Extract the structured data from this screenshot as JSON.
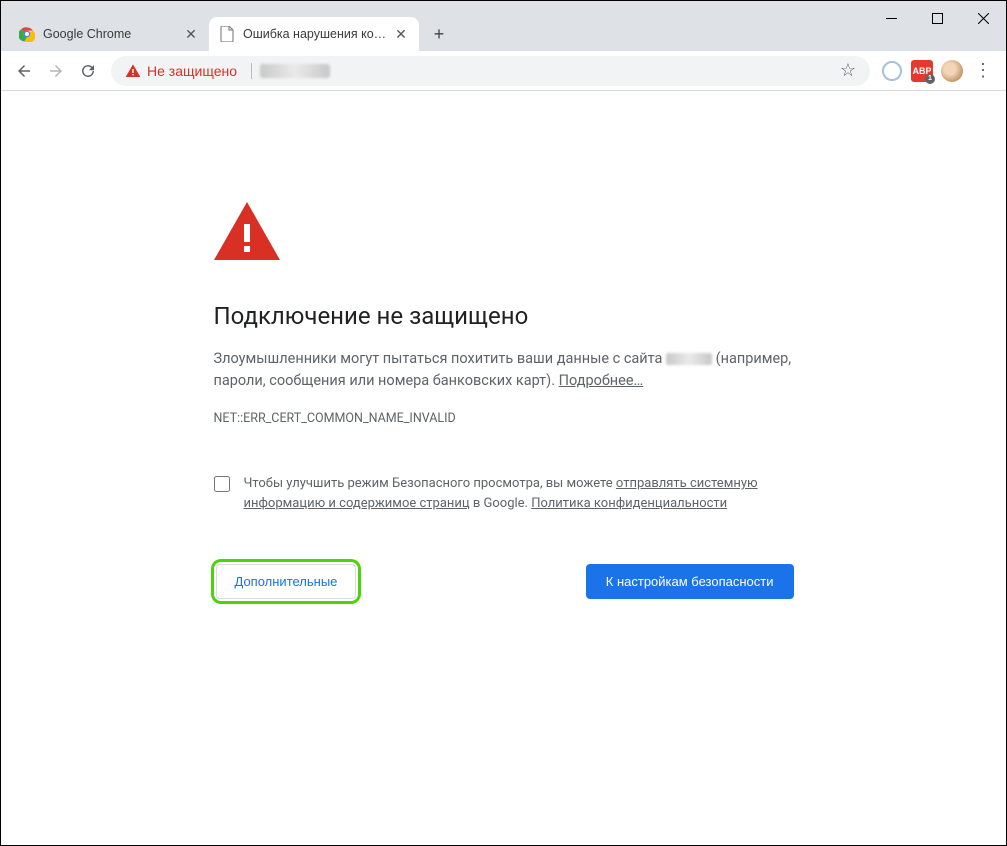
{
  "tabs": [
    {
      "title": "Google Chrome"
    },
    {
      "title": "Ошибка нарушения конфиденц"
    }
  ],
  "toolbar": {
    "security_label": "Не защищено"
  },
  "page": {
    "heading": "Подключение не защищено",
    "body_before": "Злоумышленники могут пытаться похитить ваши данные с сайта ",
    "body_after_host": " (например, пароли, сообщения или номера банковских карт). ",
    "learn_more": "Подробнее…",
    "error_code": "NET::ERR_CERT_COMMON_NAME_INVALID",
    "optin_before": "Чтобы улучшить режим Безопасного просмотра, вы можете ",
    "optin_link1": "отправлять системную информацию и содержимое страниц",
    "optin_mid": " в Google. ",
    "optin_link2": "Политика конфиденциальности",
    "advanced_label": "Дополнительные",
    "safety_label": "К настройкам безопасности"
  }
}
